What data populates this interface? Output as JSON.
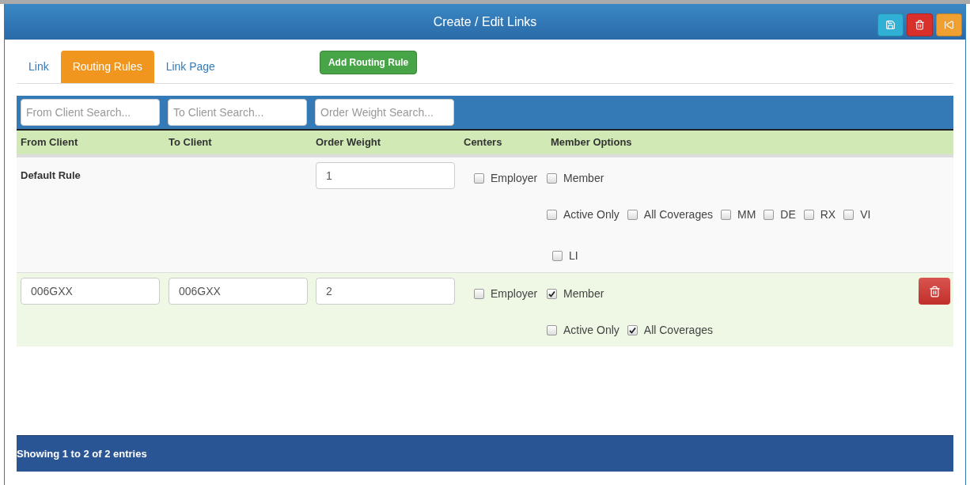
{
  "window": {
    "title": "Create / Edit Links"
  },
  "header_buttons": [
    {
      "kind": "save"
    },
    {
      "kind": "delete"
    },
    {
      "kind": "back"
    }
  ],
  "tabs": [
    {
      "label": "Link",
      "selected": false
    },
    {
      "label": "Routing Rules",
      "selected": true
    },
    {
      "label": "Link Page",
      "selected": false
    }
  ],
  "add_button": "Add Routing Rule",
  "search": [
    {
      "placeholder": "From Client Search..."
    },
    {
      "placeholder": "To Client Search..."
    },
    {
      "placeholder": "Order Weight Search..."
    }
  ],
  "table": {
    "columns": [
      "From Client",
      "To Client",
      "Order Weight",
      "Centers",
      "Member Options"
    ],
    "rows": [
      {
        "from_client": {
          "kind": "label",
          "text": "Default Rule"
        },
        "to_client": {
          "kind": "empty"
        },
        "order_weight": "1",
        "centers": [
          {
            "label": "Employer",
            "checked": false
          }
        ],
        "member_options": [
          [
            {
              "label": "Member",
              "checked": false
            }
          ],
          [
            {
              "label": "Active Only",
              "checked": false
            },
            {
              "label": "All Coverages",
              "checked": false
            },
            {
              "label": "MM",
              "checked": false
            },
            {
              "label": "DE",
              "checked": false
            },
            {
              "label": "RX",
              "checked": false
            },
            {
              "label": "VI",
              "checked": false
            }
          ],
          [
            {
              "label": "LI",
              "checked": false
            }
          ]
        ],
        "deletable": false
      },
      {
        "from_client": {
          "kind": "field",
          "text": "006GXX"
        },
        "to_client": {
          "kind": "field",
          "text": "006GXX"
        },
        "order_weight": "2",
        "centers": [
          {
            "label": "Employer",
            "checked": false
          }
        ],
        "member_options": [
          [
            {
              "label": "Member",
              "checked": true
            }
          ],
          [
            {
              "label": "Active Only",
              "checked": false
            },
            {
              "label": "All Coverages",
              "checked": true
            }
          ]
        ],
        "deletable": true
      }
    ]
  },
  "status_bar": "Showing 1 to 2 of 2 entries"
}
